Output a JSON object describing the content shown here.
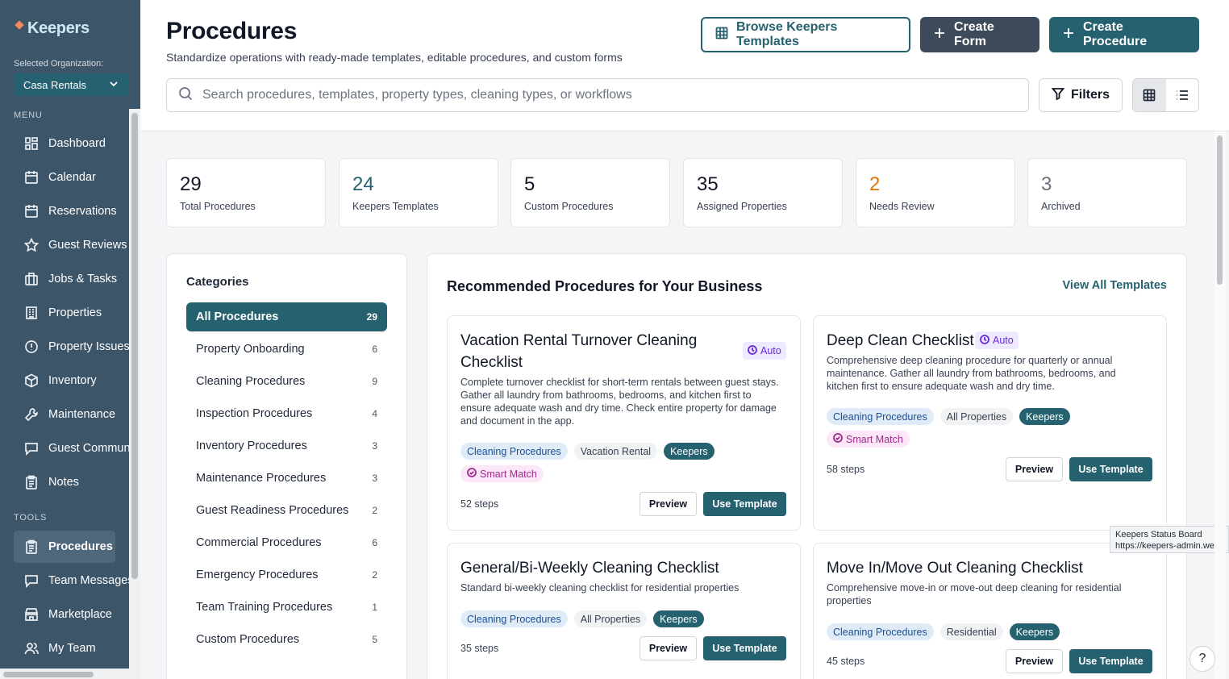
{
  "app": {
    "name": "Keepers"
  },
  "org": {
    "label": "Selected Organization:",
    "value": "Casa Rentals"
  },
  "menu": {
    "label": "MENU",
    "items": [
      {
        "label": "Dashboard",
        "icon": "dashboard-icon"
      },
      {
        "label": "Calendar",
        "icon": "calendar-icon"
      },
      {
        "label": "Reservations",
        "icon": "calendar-icon"
      },
      {
        "label": "Guest Reviews",
        "icon": "star-icon"
      },
      {
        "label": "Jobs & Tasks",
        "icon": "briefcase-icon"
      },
      {
        "label": "Properties",
        "icon": "building-icon"
      },
      {
        "label": "Property Issues",
        "icon": "alert-circle-icon"
      },
      {
        "label": "Inventory",
        "icon": "box-icon"
      },
      {
        "label": "Maintenance",
        "icon": "wrench-icon"
      },
      {
        "label": "Guest Communication",
        "icon": "chat-icon"
      },
      {
        "label": "Notes",
        "icon": "clipboard-icon"
      }
    ]
  },
  "tools": {
    "label": "TOOLS",
    "items": [
      {
        "label": "Procedures",
        "icon": "clipboard-list-icon",
        "active": true
      },
      {
        "label": "Team Messages",
        "icon": "chat-icon"
      },
      {
        "label": "Marketplace",
        "icon": "store-icon"
      },
      {
        "label": "My Team",
        "icon": "users-icon"
      }
    ]
  },
  "header": {
    "title": "Procedures",
    "subtitle": "Standardize operations with ready-made templates, editable procedures, and custom forms",
    "browse_label": "Browse Keepers Templates",
    "create_form_label": "Create Form",
    "create_procedure_label": "Create Procedure",
    "search_placeholder": "Search procedures, templates, property types, cleaning types, or workflows",
    "filters_label": "Filters"
  },
  "stats": [
    {
      "value": "29",
      "label": "Total Procedures",
      "color": "#111827"
    },
    {
      "value": "24",
      "label": "Keepers Templates",
      "color": "#25616f"
    },
    {
      "value": "5",
      "label": "Custom Procedures",
      "color": "#111827"
    },
    {
      "value": "35",
      "label": "Assigned Properties",
      "color": "#111827"
    },
    {
      "value": "2",
      "label": "Needs Review",
      "color": "#d97706"
    },
    {
      "value": "3",
      "label": "Archived",
      "color": "#6b7280"
    }
  ],
  "categories": {
    "title": "Categories",
    "items": [
      {
        "label": "All Procedures",
        "count": "29",
        "active": true
      },
      {
        "label": "Property Onboarding",
        "count": "6"
      },
      {
        "label": "Cleaning Procedures",
        "count": "9"
      },
      {
        "label": "Inspection Procedures",
        "count": "4"
      },
      {
        "label": "Inventory Procedures",
        "count": "3"
      },
      {
        "label": "Maintenance Procedures",
        "count": "3"
      },
      {
        "label": "Guest Readiness Procedures",
        "count": "2"
      },
      {
        "label": "Commercial Procedures",
        "count": "6"
      },
      {
        "label": "Emergency Procedures",
        "count": "2"
      },
      {
        "label": "Team Training Procedures",
        "count": "1"
      },
      {
        "label": "Custom Procedures",
        "count": "5"
      }
    ]
  },
  "recommended": {
    "title": "Recommended Procedures for Your Business",
    "view_all": "View All Templates",
    "auto_label": "Auto",
    "smart_match": "Smart Match",
    "preview": "Preview",
    "use": "Use Template",
    "cards": [
      {
        "title": "Vacation Rental Turnover Cleaning Checklist",
        "desc": "Complete turnover checklist for short-term rentals between guest stays. Gather all laundry from bathrooms, bedrooms, and kitchen first to ensure adequate wash and dry time. Check entire property for damage and document in the app.",
        "tags": [
          "Cleaning Procedures",
          "Vacation Rental",
          "Keepers"
        ],
        "steps": "52 steps"
      },
      {
        "title": "Deep Clean Checklist",
        "desc": "Comprehensive deep cleaning procedure for quarterly or annual maintenance. Gather all laundry from bathrooms, bedrooms, and kitchen first to ensure adequate wash and dry time.",
        "tags": [
          "Cleaning Procedures",
          "All Properties",
          "Keepers"
        ],
        "steps": "58 steps"
      },
      {
        "title": "General/Bi-Weekly Cleaning Checklist",
        "desc": "Standard bi-weekly cleaning checklist for residential properties",
        "tags": [
          "Cleaning Procedures",
          "All Properties",
          "Keepers"
        ],
        "steps": "35 steps"
      },
      {
        "title": "Move In/Move Out Cleaning Checklist",
        "desc": "Comprehensive move-in or move-out deep cleaning for residential properties",
        "tags": [
          "Cleaning Procedures",
          "Residential",
          "Keepers"
        ],
        "steps": "45 steps"
      }
    ]
  },
  "tooltip": {
    "line1": "Keepers Status Board",
    "line2": "https://keepers-admin.web"
  },
  "help": "?"
}
